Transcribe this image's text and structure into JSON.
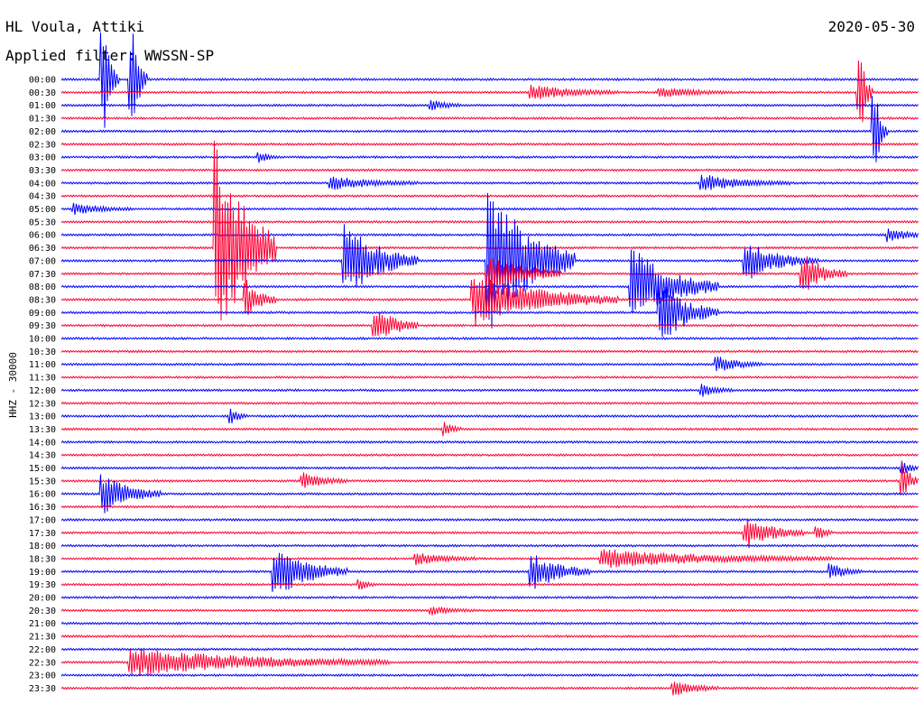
{
  "header": {
    "station": "HL Voula, Attiki",
    "filter": "Applied filter: WWSSN-SP",
    "date": "2020-05-30",
    "channel_label": "HHZ - 30000"
  },
  "colors": {
    "even_trace": "#0000ff",
    "odd_trace": "#ff0033",
    "background": "#ffffff"
  },
  "chart_data": {
    "type": "line",
    "description": "24-hour helicorder seismogram, one 30-minute trace per row",
    "title": "",
    "xlabel": "",
    "ylabel": "HHZ - 30000",
    "row_labels": [
      "00:00",
      "00:30",
      "01:00",
      "01:30",
      "02:00",
      "02:30",
      "03:00",
      "03:30",
      "04:00",
      "04:30",
      "05:00",
      "05:30",
      "06:00",
      "06:30",
      "07:00",
      "07:30",
      "08:00",
      "08:30",
      "09:00",
      "09:30",
      "10:00",
      "10:30",
      "11:00",
      "11:30",
      "12:00",
      "12:30",
      "13:00",
      "13:30",
      "14:00",
      "14:30",
      "15:00",
      "15:30",
      "16:00",
      "16:30",
      "17:00",
      "17:30",
      "18:00",
      "18:30",
      "19:00",
      "19:30",
      "20:00",
      "20:30",
      "21:00",
      "21:30",
      "22:00",
      "22:30",
      "23:00",
      "23:30"
    ],
    "x_range_minutes": [
      0,
      30
    ],
    "events": [
      {
        "row": 0,
        "minute": 1.5,
        "amplitude": 4,
        "duration": 0.5
      },
      {
        "row": 0,
        "minute": 2.5,
        "amplitude": 4,
        "duration": 0.5
      },
      {
        "row": 1,
        "minute": 16.5,
        "amplitude": 0.6,
        "duration": 3
      },
      {
        "row": 1,
        "minute": 21,
        "amplitude": 0.4,
        "duration": 2.5
      },
      {
        "row": 1,
        "minute": 28,
        "amplitude": 3,
        "duration": 0.4
      },
      {
        "row": 2,
        "minute": 13,
        "amplitude": 0.4,
        "duration": 1
      },
      {
        "row": 4,
        "minute": 28.5,
        "amplitude": 3,
        "duration": 0.4
      },
      {
        "row": 6,
        "minute": 7,
        "amplitude": 0.4,
        "duration": 0.5
      },
      {
        "row": 8,
        "minute": 9.5,
        "amplitude": 0.5,
        "duration": 3
      },
      {
        "row": 8,
        "minute": 22.5,
        "amplitude": 0.6,
        "duration": 3
      },
      {
        "row": 10,
        "minute": 0.5,
        "amplitude": 0.4,
        "duration": 2
      },
      {
        "row": 12,
        "minute": 29,
        "amplitude": 0.5,
        "duration": 1.5
      },
      {
        "row": 13,
        "minute": 5.5,
        "amplitude": 9,
        "duration": 2
      },
      {
        "row": 14,
        "minute": 10,
        "amplitude": 3,
        "duration": 2.5
      },
      {
        "row": 14,
        "minute": 15,
        "amplitude": 6,
        "duration": 3
      },
      {
        "row": 14,
        "minute": 24,
        "amplitude": 1.5,
        "duration": 2.5
      },
      {
        "row": 15,
        "minute": 15,
        "amplitude": 1.5,
        "duration": 2.5
      },
      {
        "row": 15,
        "minute": 26,
        "amplitude": 1.5,
        "duration": 1.5
      },
      {
        "row": 16,
        "minute": 20,
        "amplitude": 3,
        "duration": 3
      },
      {
        "row": 17,
        "minute": 6.5,
        "amplitude": 1.5,
        "duration": 1
      },
      {
        "row": 17,
        "minute": 14.5,
        "amplitude": 2,
        "duration": 5
      },
      {
        "row": 18,
        "minute": 21,
        "amplitude": 2.5,
        "duration": 2
      },
      {
        "row": 19,
        "minute": 11,
        "amplitude": 1.5,
        "duration": 1.5
      },
      {
        "row": 22,
        "minute": 23,
        "amplitude": 0.6,
        "duration": 1.5
      },
      {
        "row": 24,
        "minute": 22.5,
        "amplitude": 0.5,
        "duration": 1
      },
      {
        "row": 26,
        "minute": 6,
        "amplitude": 0.6,
        "duration": 0.5
      },
      {
        "row": 27,
        "minute": 13.5,
        "amplitude": 0.5,
        "duration": 0.5
      },
      {
        "row": 30,
        "minute": 29.5,
        "amplitude": 0.5,
        "duration": 0.5
      },
      {
        "row": 31,
        "minute": 8.5,
        "amplitude": 0.6,
        "duration": 1.5
      },
      {
        "row": 31,
        "minute": 29.5,
        "amplitude": 1.5,
        "duration": 0.5
      },
      {
        "row": 32,
        "minute": 1.5,
        "amplitude": 1.5,
        "duration": 2
      },
      {
        "row": 35,
        "minute": 24,
        "amplitude": 1.2,
        "duration": 2
      },
      {
        "row": 35,
        "minute": 26.5,
        "amplitude": 0.6,
        "duration": 0.5
      },
      {
        "row": 37,
        "minute": 12.5,
        "amplitude": 0.5,
        "duration": 2
      },
      {
        "row": 37,
        "minute": 19,
        "amplitude": 0.7,
        "duration": 8
      },
      {
        "row": 38,
        "minute": 7.5,
        "amplitude": 2,
        "duration": 2.5
      },
      {
        "row": 38,
        "minute": 16.5,
        "amplitude": 1.5,
        "duration": 2
      },
      {
        "row": 38,
        "minute": 27,
        "amplitude": 0.6,
        "duration": 1
      },
      {
        "row": 39,
        "minute": 10.5,
        "amplitude": 0.4,
        "duration": 0.5
      },
      {
        "row": 41,
        "minute": 13,
        "amplitude": 0.3,
        "duration": 1.5
      },
      {
        "row": 45,
        "minute": 2.5,
        "amplitude": 1.1,
        "duration": 9
      },
      {
        "row": 47,
        "minute": 21.5,
        "amplitude": 0.6,
        "duration": 1.5
      }
    ]
  }
}
